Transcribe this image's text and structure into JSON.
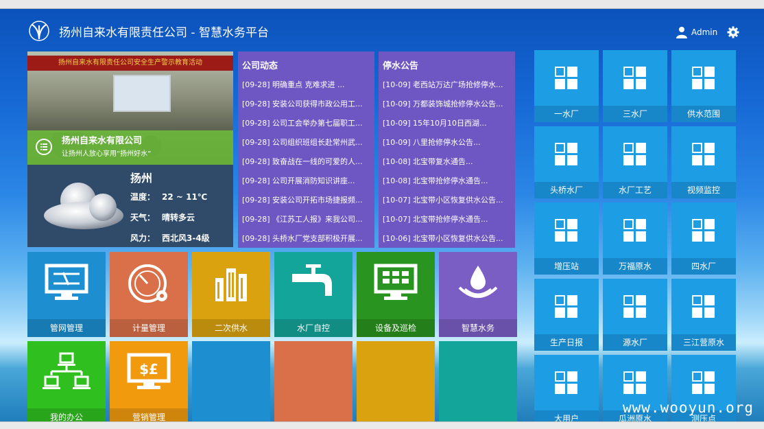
{
  "header": {
    "title": "扬州自来水有限责任公司 - 智慧水务平台",
    "user": "Admin"
  },
  "banner": {
    "sign": "扬州自来水有限责任公司安全生产警示教育活动",
    "title": "扬州自来水有限公司",
    "subtitle": "让扬州人放心享用“扬州好水”"
  },
  "weather": {
    "city": "扬州",
    "temp_label": "温度：",
    "temp": "22 ~ 11℃",
    "sky_label": "天气：",
    "sky": "晴转多云",
    "wind_label": "风力：",
    "wind": "西北风3-4级"
  },
  "company_news": {
    "title": "公司动态",
    "items": [
      "[09-28] 明确重点 克难求进 ...",
      "[09-28] 安装公司获得市政公用工...",
      "[09-28] 公司工会举办第七届职工...",
      "[09-28] 公司组织班组长赴常州武...",
      "[09-28] 致奋战在一线的可爱的人...",
      "[09-28] 公司开展消防知识讲座...",
      "[09-28] 安装公司开拓市场捷报频...",
      "[09-28] 《江苏工人报》来我公司...",
      "[09-28] 头桥水厂党支部积极开展..."
    ]
  },
  "outage_notice": {
    "title": "停水公告",
    "items": [
      "[10-09] 老西站万达广场抢修停水...",
      "[10-09] 万都装饰城抢修停水公告...",
      "[10-09] 15年10月10日西湖...",
      "[10-09] 八里抢修停水公告...",
      "[10-08] 北宝带复水通告...",
      "[10-08] 北宝带抢修停水通告...",
      "[10-07] 北宝带小区恢复供水公告...",
      "[10-07] 北宝带抢修停水通告...",
      "[10-06] 北宝带小区恢复供水公告..."
    ]
  },
  "modules": {
    "pipe_network": "管网管理",
    "metering": "计量管理",
    "secondary_supply": "二次供水",
    "plant_control": "水厂自控",
    "equipment_patrol": "设备及巡检",
    "smart_water": "智慧水务",
    "my_office": "我的办公",
    "marketing": "营销管理"
  },
  "stations": [
    "一水厂",
    "三水厂",
    "供水范围",
    "头桥水厂",
    "水厂工艺",
    "视频监控",
    "增压站",
    "万福原水",
    "四水厂",
    "生产日报",
    "源水厂",
    "三江营原水",
    "大用户",
    "瓜洲原水",
    "测压点"
  ],
  "colors": {
    "blue": "#1d8fd0",
    "orange": "#d9704a",
    "gold": "#d9a20e",
    "teal": "#14a59a",
    "green": "#2a9420",
    "purple": "#7b5ec4",
    "lime": "#2fc01f",
    "amber": "#f29a0e",
    "news": "#6f57c3",
    "side": "#1d9de3",
    "weather": "#2f4b69"
  },
  "watermark": "www.wooyun.org"
}
